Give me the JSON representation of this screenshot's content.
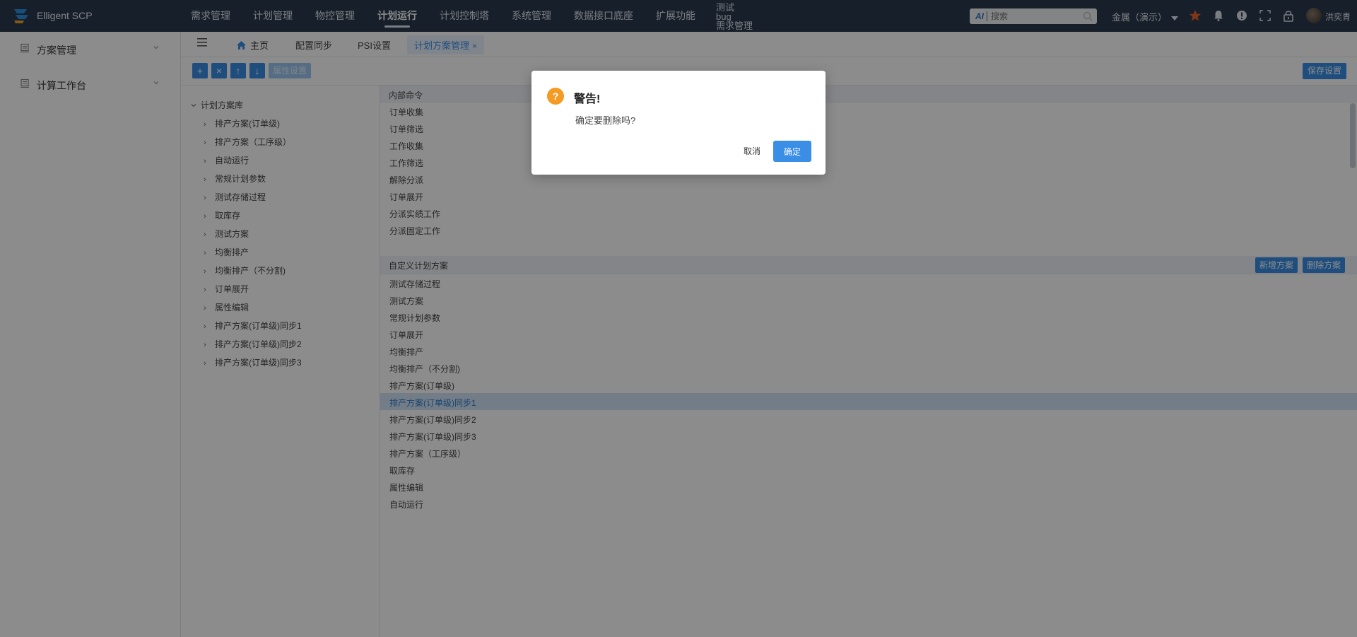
{
  "app": {
    "title": "Elligent SCP"
  },
  "topnav": {
    "items": [
      {
        "label": "需求管理",
        "active": false
      },
      {
        "label": "计划管理",
        "active": false
      },
      {
        "label": "物控管理",
        "active": false
      },
      {
        "label": "计划运行",
        "active": true
      },
      {
        "label": "计划控制塔",
        "active": false
      },
      {
        "label": "系统管理",
        "active": false
      },
      {
        "label": "数据接口底座",
        "active": false
      },
      {
        "label": "扩展功能",
        "active": false
      }
    ],
    "stacked": [
      "测试",
      "bug",
      "需求管理"
    ]
  },
  "search": {
    "ai_label": "AI",
    "placeholder": "搜索"
  },
  "company": {
    "label": "金属（演示）"
  },
  "user": {
    "name": "洪奕青"
  },
  "sidebar": {
    "items": [
      {
        "label": "方案管理"
      },
      {
        "label": "计算工作台"
      }
    ]
  },
  "tabs": {
    "home": "主页",
    "items": [
      "配置同步",
      "PSI设置"
    ],
    "active": "计划方案管理",
    "close": "×"
  },
  "toolbar": {
    "add": "+",
    "remove": "×",
    "up": "↑",
    "down": "↓",
    "attr": "属性设置",
    "save": "保存设置"
  },
  "tree": {
    "root": "计划方案库",
    "nodes": [
      "排产方案(订单级)",
      "排产方案（工序级）",
      "自动运行",
      "常规计划参数",
      "测试存储过程",
      "取库存",
      "测试方案",
      "均衡排产",
      "均衡排产（不分割)",
      "订单展开",
      "属性编辑",
      "排产方案(订单级)同步1",
      "排产方案(订单级)同步2",
      "排产方案(订单级)同步3"
    ]
  },
  "commands": {
    "header": "内部命令",
    "items": [
      "订单收集",
      "订单筛选",
      "工作收集",
      "工作筛选",
      "解除分派",
      "订单展开",
      "分派实绩工作",
      "分派固定工作"
    ]
  },
  "plans": {
    "header": "自定义计划方案",
    "add_button": "新增方案",
    "delete_button": "删除方案",
    "selected_index": 7,
    "items": [
      "测试存储过程",
      "测试方案",
      "常规计划参数",
      "订单展开",
      "均衡排产",
      "均衡排产（不分割)",
      "排产方案(订单级)",
      "排产方案(订单级)同步1",
      "排产方案(订单级)同步2",
      "排产方案(订单级)同步3",
      "排产方案（工序级）",
      "取库存",
      "属性编辑",
      "自动运行"
    ]
  },
  "dialog": {
    "icon": "?",
    "title": "警告!",
    "message": "确定要删除吗?",
    "cancel": "取消",
    "ok": "确定"
  },
  "colors": {
    "topbar": "#2b3a4e",
    "primary": "#3a8ee6",
    "warning": "#f59a23",
    "selected_row": "#cfe3f7"
  }
}
